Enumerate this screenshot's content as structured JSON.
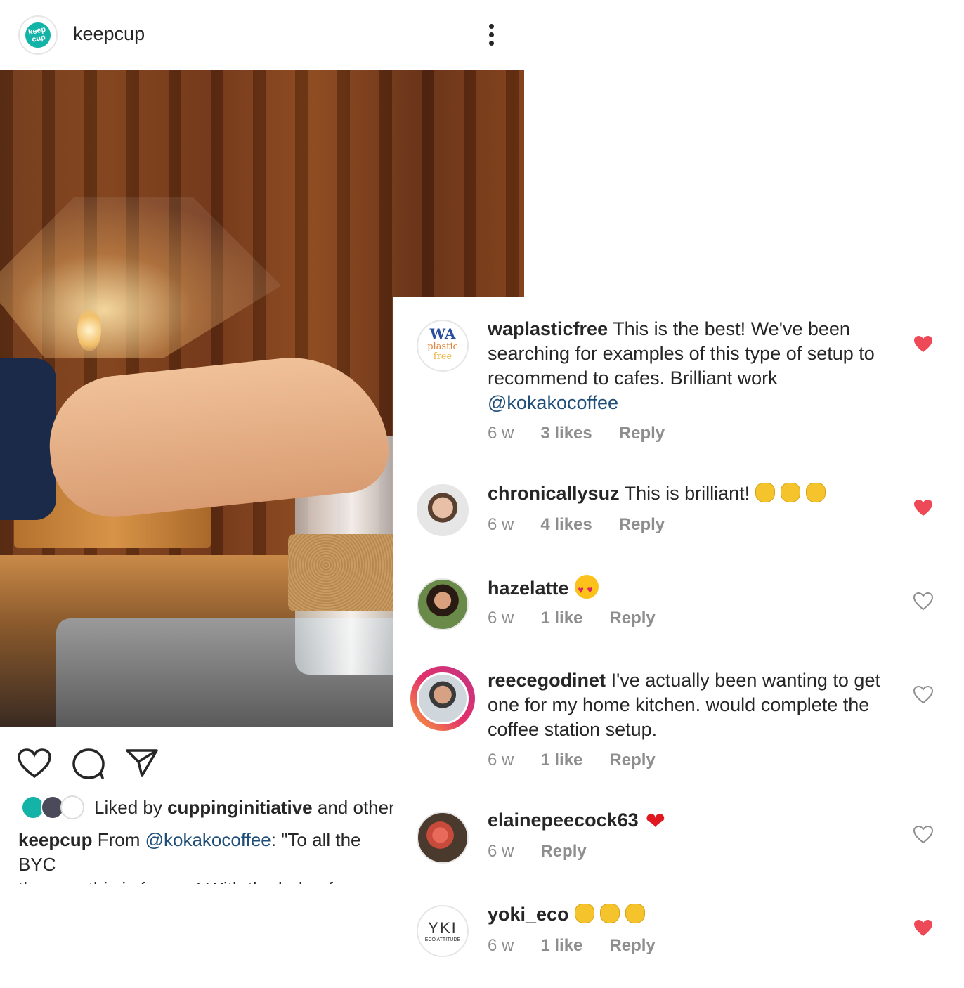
{
  "post": {
    "username": "keepcup",
    "logo_text": "keep cup",
    "liked_by_prefix": "Liked by ",
    "liked_by_user": "cuppinginitiative",
    "liked_by_suffix": " and other",
    "caption_user": "keepcup",
    "caption_from": " From ",
    "caption_mention": "@kokakocoffee",
    "caption_text_1": ": \"To all the BYC",
    "caption_text_2": "there — this is for you! With the help of our fri.."
  },
  "comments": [
    {
      "user": "waplasticfree",
      "text": " This is the best! We've been searching for examples of this type of setup to recommend to cafes. Brilliant work ",
      "mention": "@kokakocoffee",
      "time": "6 w",
      "likes": "3 likes",
      "reply": "Reply",
      "avatar_text_1": "WA",
      "avatar_text_2": "plastic",
      "avatar_text_3": "free",
      "liked": true
    },
    {
      "user": "chronicallysuz",
      "text": " This is brilliant!",
      "emoji": "clapping-hands x3",
      "time": "6 w",
      "likes": "4 likes",
      "reply": "Reply",
      "liked": true
    },
    {
      "user": "hazelatte",
      "emoji": "heart-eyes",
      "time": "6 w",
      "likes": "1 like",
      "reply": "Reply",
      "liked": false
    },
    {
      "user": "reecegodinet",
      "text": " I've actually been wanting to get one for my home kitchen.  would complete the coffee station setup.",
      "time": "6 w",
      "likes": "1 like",
      "reply": "Reply",
      "liked": false
    },
    {
      "user": "elainepeecock63",
      "emoji": "red-heart",
      "time": "6 w",
      "reply": "Reply",
      "liked": false
    },
    {
      "user": "yoki_eco",
      "emoji": "clapping-hands x3",
      "time": "6 w",
      "likes": "1 like",
      "reply": "Reply",
      "avatar_text_1": "YKI",
      "avatar_text_2": "ECO ATTITUDE",
      "liked": true
    }
  ],
  "colors": {
    "heart_liked": "#ed4956",
    "heart_outline": "#8e8e8e",
    "mention": "#1f4e79",
    "meta": "#8e8e8e",
    "brand": "#13b3a8"
  },
  "icons": [
    "more-options-icon",
    "like-icon",
    "comment-icon",
    "share-icon",
    "heart-icon"
  ]
}
